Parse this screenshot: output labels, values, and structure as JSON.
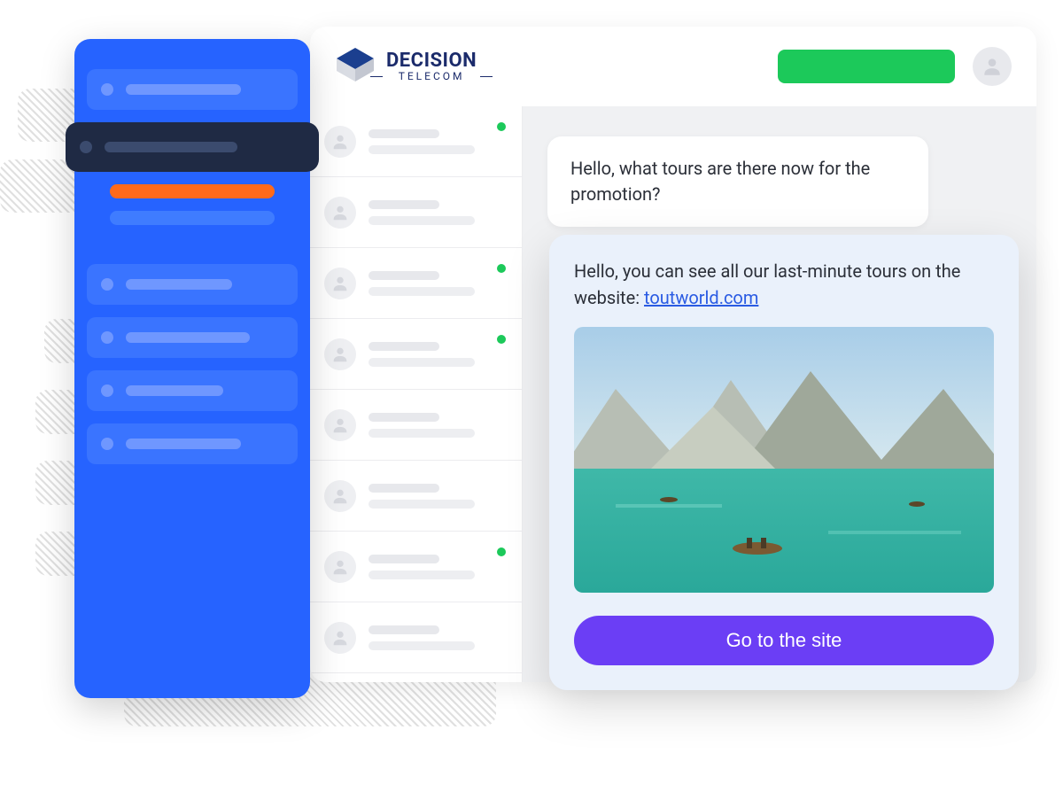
{
  "brand": {
    "word1": "DECISION",
    "word2": "TELECOM"
  },
  "header": {
    "action_color": "#1cc95a"
  },
  "chat": {
    "incoming_message": "Hello, what tours are there now for the promotion?",
    "outgoing_message_prefix": "Hello, you can see all our last-minute tours on the website: ",
    "outgoing_link_text": "toutworld.com",
    "cta_label": "Go to the site"
  },
  "conversations": [
    {
      "online": true
    },
    {
      "online": false
    },
    {
      "online": true
    },
    {
      "online": true
    },
    {
      "online": false
    },
    {
      "online": false
    },
    {
      "online": true
    },
    {
      "online": false
    }
  ],
  "sidebar": {
    "items": [
      {
        "style": "dim"
      },
      {
        "style": "dark"
      },
      {
        "sub": "orange"
      },
      {
        "sub": "blue"
      },
      {
        "style": "dim"
      },
      {
        "style": "dim"
      },
      {
        "style": "dim"
      },
      {
        "style": "dim"
      }
    ]
  }
}
